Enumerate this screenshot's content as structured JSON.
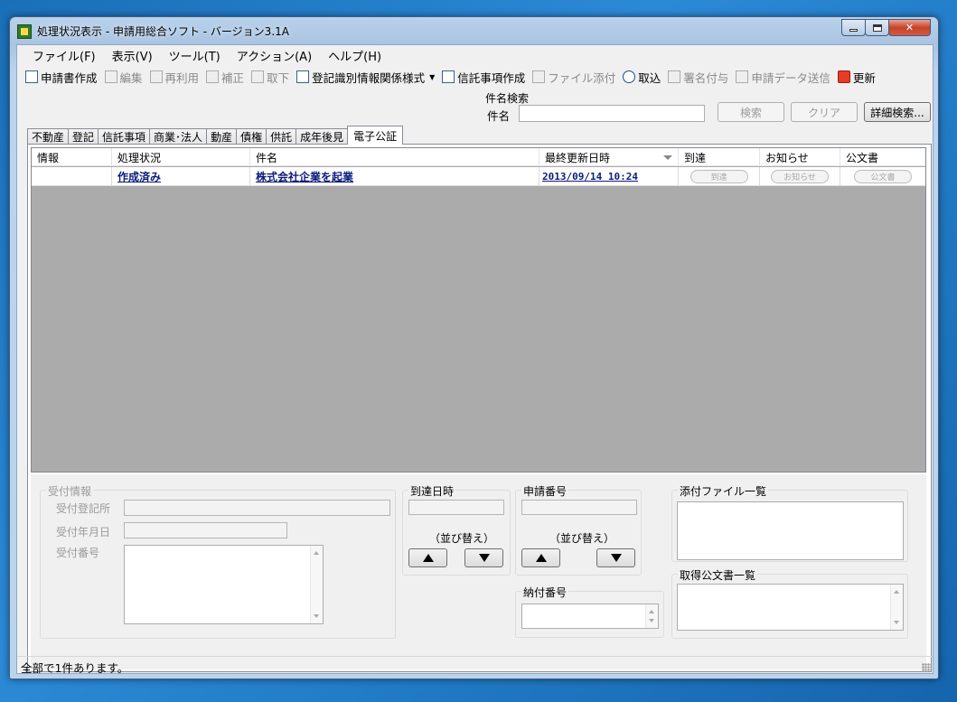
{
  "window": {
    "title": "処理状況表示 - 申請用総合ソフト - バージョン3.1A"
  },
  "menu": [
    "ファイル(F)",
    "表示(V)",
    "ツール(T)",
    "アクション(A)",
    "ヘルプ(H)"
  ],
  "toolbar": {
    "create": "申請書作成",
    "edit": "編集",
    "reuse": "再利用",
    "amend": "補正",
    "withdraw": "取下",
    "reg_form": "登記識別情報関係様式",
    "trust_create": "信託事項作成",
    "attach": "ファイル添付",
    "import": "取込",
    "sign": "署名付与",
    "send": "申請データ送信",
    "refresh": "更新"
  },
  "search": {
    "group_label": "件名検索",
    "field_label": "件名",
    "value": "",
    "search_btn": "検索",
    "clear_btn": "クリア",
    "detail_btn": "詳細検索..."
  },
  "tabs": [
    "不動産",
    "登記",
    "信託事項",
    "商業･法人",
    "動産",
    "債権",
    "供託",
    "成年後見",
    "電子公証"
  ],
  "active_tab": "電子公証",
  "grid": {
    "columns": [
      "情報",
      "処理状況",
      "件名",
      "最終更新日時",
      "到達",
      "お知らせ",
      "公文書"
    ],
    "rows": [
      {
        "info": "",
        "status": "作成済み",
        "subject": "株式会社企業を起業",
        "updated": "2013/09/14 10:24",
        "arrival": "到達",
        "notice": "お知らせ",
        "document": "公文書"
      }
    ]
  },
  "receipt": {
    "legend": "受付情報",
    "office_label": "受付登記所",
    "date_label": "受付年月日",
    "number_label": "受付番号"
  },
  "arrival_dt": {
    "legend": "到達日時",
    "sort_label": "（並び替え）"
  },
  "app_number": {
    "legend": "申請番号",
    "sort_label": "（並び替え）"
  },
  "payment": {
    "legend": "納付番号"
  },
  "attachments": {
    "legend": "添付ファイル一覧"
  },
  "acquired_docs": {
    "legend": "取得公文書一覧"
  },
  "status": {
    "text": "全部で1件あります。"
  }
}
